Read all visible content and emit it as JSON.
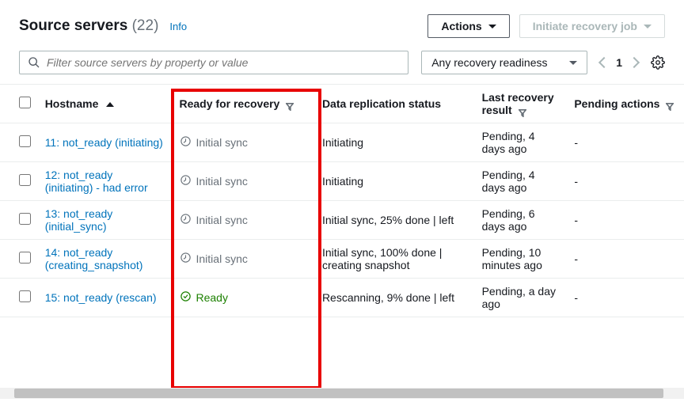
{
  "header": {
    "title": "Source servers",
    "count": "(22)",
    "info": "Info",
    "actions": "Actions",
    "initiate": "Initiate recovery job"
  },
  "toolbar": {
    "search_placeholder": "Filter source servers by property or value",
    "readiness_select": "Any recovery readiness",
    "page": "1"
  },
  "columns": {
    "hostname": "Hostname",
    "ready": "Ready for recovery",
    "replication": "Data replication status",
    "last": "Last recovery result",
    "pending": "Pending actions"
  },
  "rows": [
    {
      "hostname": "11: not_ready (initiating)",
      "ready_status": "initial",
      "ready_text": "Initial sync",
      "replication": "Initiating",
      "last": "Pending, 4 days ago",
      "pending": "-"
    },
    {
      "hostname": "12: not_ready (initiating) - had error",
      "ready_status": "initial",
      "ready_text": "Initial sync",
      "replication": "Initiating",
      "last": "Pending, 4 days ago",
      "pending": "-"
    },
    {
      "hostname": "13: not_ready (initial_sync)",
      "ready_status": "initial",
      "ready_text": "Initial sync",
      "replication": "Initial sync, 25% done | left",
      "last": "Pending, 6 days ago",
      "pending": "-"
    },
    {
      "hostname": "14: not_ready (creating_snapshot)",
      "ready_status": "initial",
      "ready_text": "Initial sync",
      "replication": "Initial sync, 100% done | creating snapshot",
      "last": "Pending, 10 minutes ago",
      "pending": "-"
    },
    {
      "hostname": "15: not_ready (rescan)",
      "ready_status": "ready",
      "ready_text": "Ready",
      "replication": "Rescanning, 9% done | left",
      "last": "Pending, a day ago",
      "pending": "-"
    }
  ]
}
